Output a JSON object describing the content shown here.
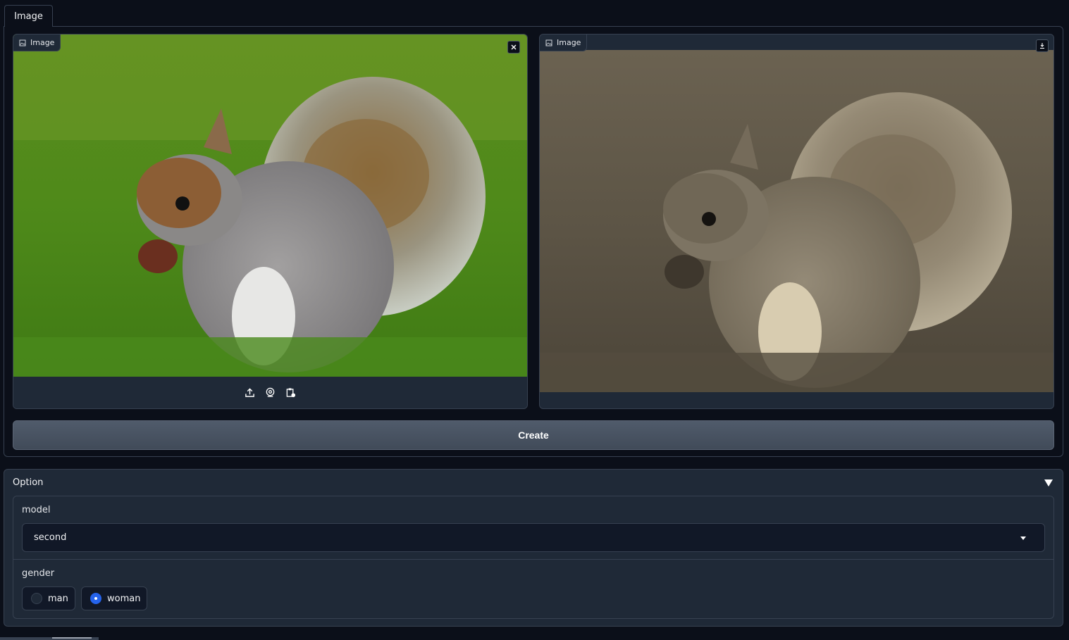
{
  "tabs": [
    {
      "label": "Image",
      "active": true
    }
  ],
  "input_image": {
    "label": "Image",
    "clear_icon": "close-icon",
    "sources": [
      "upload-icon",
      "webcam-icon",
      "clipboard-icon"
    ]
  },
  "output_image": {
    "label": "Image",
    "download_icon": "download-icon"
  },
  "create_button": {
    "label": "Create"
  },
  "options": {
    "title": "Option",
    "expanded": true,
    "model": {
      "label": "model",
      "value": "second"
    },
    "gender": {
      "label": "gender",
      "choices": [
        {
          "label": "man",
          "selected": false
        },
        {
          "label": "woman",
          "selected": true
        }
      ]
    }
  },
  "colors": {
    "background": "#0b0f19",
    "panel": "#1f2937",
    "border": "#374151",
    "button": "#4b5563",
    "accent": "#2563eb"
  }
}
